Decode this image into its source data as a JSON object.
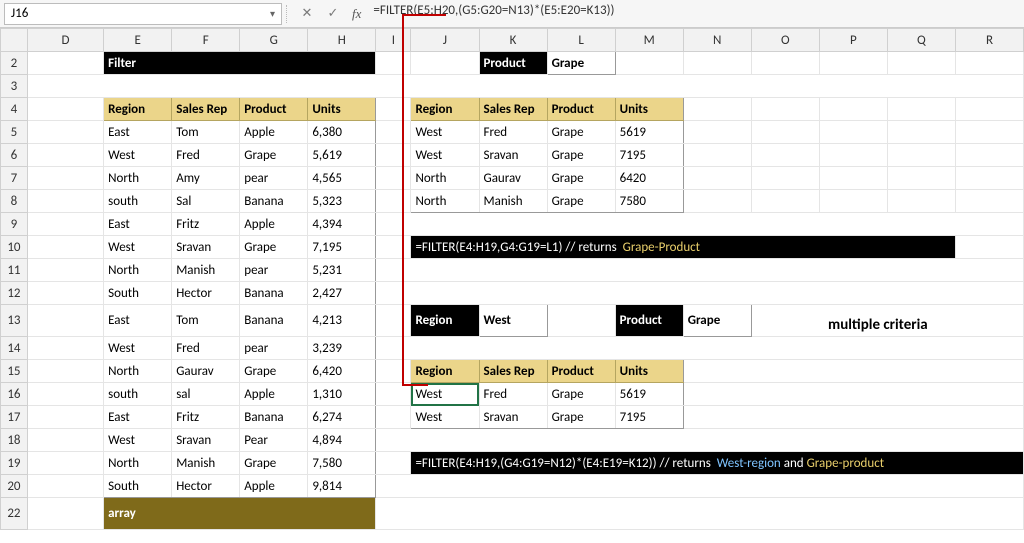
{
  "formula_bar": {
    "cell_ref": "J16",
    "cancel_glyph": "✕",
    "accept_glyph": "✓",
    "fx_label": "fx",
    "formula": "=FILTER(E5:H20,(G5:G20=N13)*(E5:E20=K13))"
  },
  "col_letters": [
    "D",
    "E",
    "F",
    "G",
    "H",
    "I",
    "J",
    "K",
    "L",
    "M",
    "N",
    "O",
    "P",
    "Q",
    "R"
  ],
  "row_numbers": [
    "2",
    "3",
    "4",
    "5",
    "6",
    "7",
    "8",
    "9",
    "10",
    "11",
    "12",
    "13",
    "14",
    "15",
    "16",
    "17",
    "18",
    "19",
    "20",
    "22"
  ],
  "left": {
    "filter_title": "Filter",
    "headers": [
      "Region",
      "Sales Rep",
      "Product",
      "Units"
    ],
    "rows": [
      [
        "East",
        "Tom",
        "Apple",
        "6,380"
      ],
      [
        "West",
        "Fred",
        "Grape",
        "5,619"
      ],
      [
        "North",
        "Amy",
        "pear",
        "4,565"
      ],
      [
        "south",
        "Sal",
        "Banana",
        "5,323"
      ],
      [
        "East",
        "Fritz",
        "Apple",
        "4,394"
      ],
      [
        "West",
        "Sravan",
        "Grape",
        "7,195"
      ],
      [
        "North",
        "Manish",
        "pear",
        "5,231"
      ],
      [
        "South",
        "Hector",
        "Banana",
        "2,427"
      ],
      [
        "East",
        "Tom",
        "Banana",
        "4,213"
      ],
      [
        "West",
        "Fred",
        "pear",
        "3,239"
      ],
      [
        "North",
        "Gaurav",
        "Grape",
        "6,420"
      ],
      [
        "south",
        "sal",
        "Apple",
        "1,310"
      ],
      [
        "East",
        "Fritz",
        "Banana",
        "6,274"
      ],
      [
        "West",
        "Sravan",
        "Pear",
        "4,894"
      ],
      [
        "North",
        "Manish",
        "Grape",
        "7,580"
      ],
      [
        "South",
        "Hector",
        "Apple",
        "9,814"
      ]
    ],
    "array_label": "array"
  },
  "top_filter": {
    "criteria_label": "Product",
    "criteria_value": "Grape",
    "headers": [
      "Region",
      "Sales Rep",
      "Product",
      "Units"
    ],
    "rows": [
      [
        "West",
        "Fred",
        "Grape",
        "5619"
      ],
      [
        "West",
        "Sravan",
        "Grape",
        "7195"
      ],
      [
        "North",
        "Gaurav",
        "Grape",
        "6420"
      ],
      [
        "North",
        "Manish",
        "Grape",
        "7580"
      ]
    ],
    "caption_formula": "=FILTER(E4:H19,G4:G19=L1)  // returns",
    "caption_tag": "Grape-Product"
  },
  "bottom_filter": {
    "region_label": "Region",
    "region_value": "West",
    "product_label": "Product",
    "product_value": "Grape",
    "side_note": "multiple criteria",
    "headers": [
      "Region",
      "Sales Rep",
      "Product",
      "Units"
    ],
    "rows": [
      [
        "West",
        "Fred",
        "Grape",
        "5619"
      ],
      [
        "West",
        "Sravan",
        "Grape",
        "7195"
      ]
    ],
    "caption_formula": "=FILTER(E4:H19,(G4:G19=N12)*(E4:E19=K12))  //  returns",
    "caption_tag1": "West-region",
    "caption_and": "and",
    "caption_tag2": "Grape-product"
  }
}
